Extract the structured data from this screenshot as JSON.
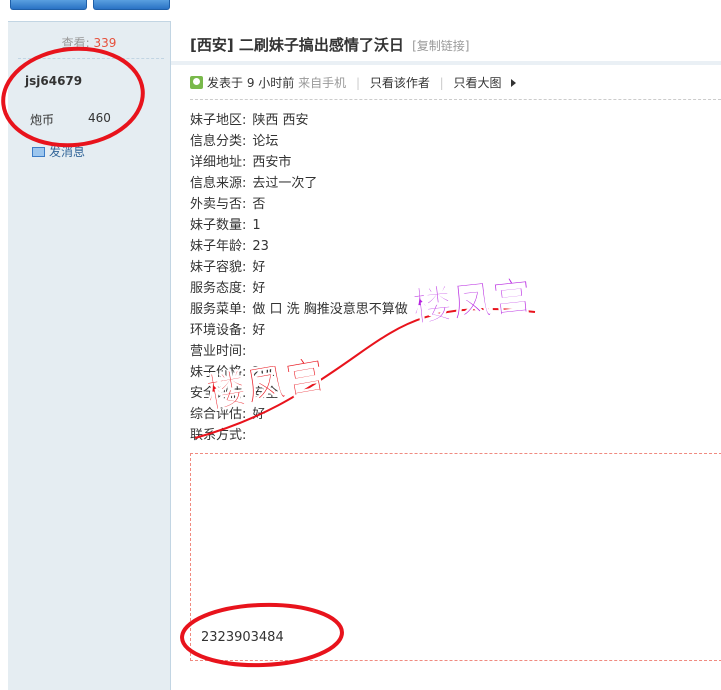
{
  "sidebar": {
    "views_label": "查看:",
    "views_count": "339",
    "username": "jsj64679",
    "stat_label": "炮币",
    "stat_value": "460",
    "message_label": "发消息"
  },
  "post": {
    "title": "[西安] 二刷妹子搞出感情了沃日",
    "copy_link": "[复制链接]",
    "posted": "发表于 9 小时前",
    "source": "来自手机",
    "only_author": "只看该作者",
    "big_image": "只看大图",
    "fields": [
      {
        "k": "妹子地区:",
        "v": "陕西 西安"
      },
      {
        "k": "信息分类:",
        "v": "论坛"
      },
      {
        "k": "详细地址:",
        "v": "西安市"
      },
      {
        "k": "信息来源:",
        "v": "去过一次了"
      },
      {
        "k": "外卖与否:",
        "v": "否"
      },
      {
        "k": "妹子数量:",
        "v": "1"
      },
      {
        "k": "妹子年龄:",
        "v": "23"
      },
      {
        "k": "妹子容貌:",
        "v": "好"
      },
      {
        "k": "服务态度:",
        "v": "好"
      },
      {
        "k": "服务菜单:",
        "v": "做 口 洗 胸推没意思不算做"
      },
      {
        "k": "环境设备:",
        "v": "好"
      },
      {
        "k": "营业时间:",
        "v": ""
      },
      {
        "k": "妹子价格:",
        "v": "200"
      },
      {
        "k": "安全评估:",
        "v": "安全"
      },
      {
        "k": "综合评估:",
        "v": "好"
      },
      {
        "k": "联系方式:",
        "v": ""
      }
    ],
    "contact_number": "2323903484"
  },
  "watermark": {
    "text_left": "楼凤宫",
    "text_right": "楼凤宫"
  },
  "colors": {
    "annotation_red": "#e8131c",
    "watermark_left": "#e8131c",
    "watermark_right": "#b623e0",
    "sidebar_bg": "#e5edf2"
  }
}
